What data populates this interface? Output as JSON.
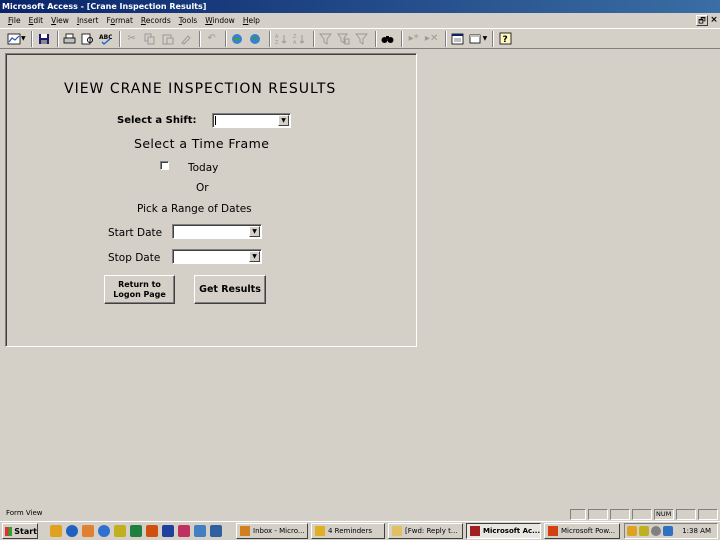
{
  "window": {
    "title": "Microsoft Access - [Crane Inspection Results]"
  },
  "menu": {
    "items": [
      {
        "label": "File",
        "key": "F"
      },
      {
        "label": "Edit",
        "key": "E"
      },
      {
        "label": "View",
        "key": "V"
      },
      {
        "label": "Insert",
        "key": "I"
      },
      {
        "label": "Format",
        "key": "o"
      },
      {
        "label": "Records",
        "key": "R"
      },
      {
        "label": "Tools",
        "key": "T"
      },
      {
        "label": "Window",
        "key": "W"
      },
      {
        "label": "Help",
        "key": "H"
      }
    ],
    "restore_glyph": "🗗",
    "close_glyph": "×"
  },
  "toolbar": {
    "icons": [
      "view-icon",
      "save-icon",
      "print-icon",
      "print-preview-icon",
      "spelling-icon",
      "cut-icon",
      "copy-icon",
      "paste-icon",
      "format-painter-icon",
      "undo-icon",
      "insert-hyperlink-icon",
      "web-toolbar-icon",
      "sort-ascending-icon",
      "sort-descending-icon",
      "filter-by-selection-icon",
      "filter-by-form-icon",
      "apply-filter-icon",
      "find-icon",
      "new-record-icon",
      "delete-record-icon",
      "database-window-icon",
      "new-object-icon",
      "help-icon"
    ]
  },
  "form": {
    "title": "VIEW CRANE INSPECTION RESULTS",
    "shift_label": "Select a Shift:",
    "shift_value": "",
    "time_frame_label": "Select a Time Frame",
    "today_label": "Today",
    "today_checked": false,
    "or_label": "Or",
    "range_label": "Pick a Range of Dates",
    "start_label": "Start Date",
    "start_value": "",
    "stop_label": "Stop Date",
    "stop_value": "",
    "return_button_line1": "Return to",
    "return_button_line2": "Logon Page",
    "get_results_button": "Get Results"
  },
  "status": {
    "view_text": "Form View",
    "num_indicator": "NUM"
  },
  "taskbar": {
    "start_label": "Start",
    "tasks": [
      {
        "label": "Inbox - Micro...",
        "active": false,
        "color": "#d08020"
      },
      {
        "label": "4 Reminders",
        "active": false,
        "color": "#e0b020"
      },
      {
        "label": "[Fwd: Reply t...",
        "active": false,
        "color": "#e0c060"
      },
      {
        "label": "Microsoft Ac...",
        "active": true,
        "color": "#a02020"
      },
      {
        "label": "Microsoft Pow...",
        "active": false,
        "color": "#d04010"
      }
    ],
    "clock": "1:38 AM"
  },
  "colors": {
    "face": "#d4d0c8",
    "titlebar": "#0a246a"
  }
}
